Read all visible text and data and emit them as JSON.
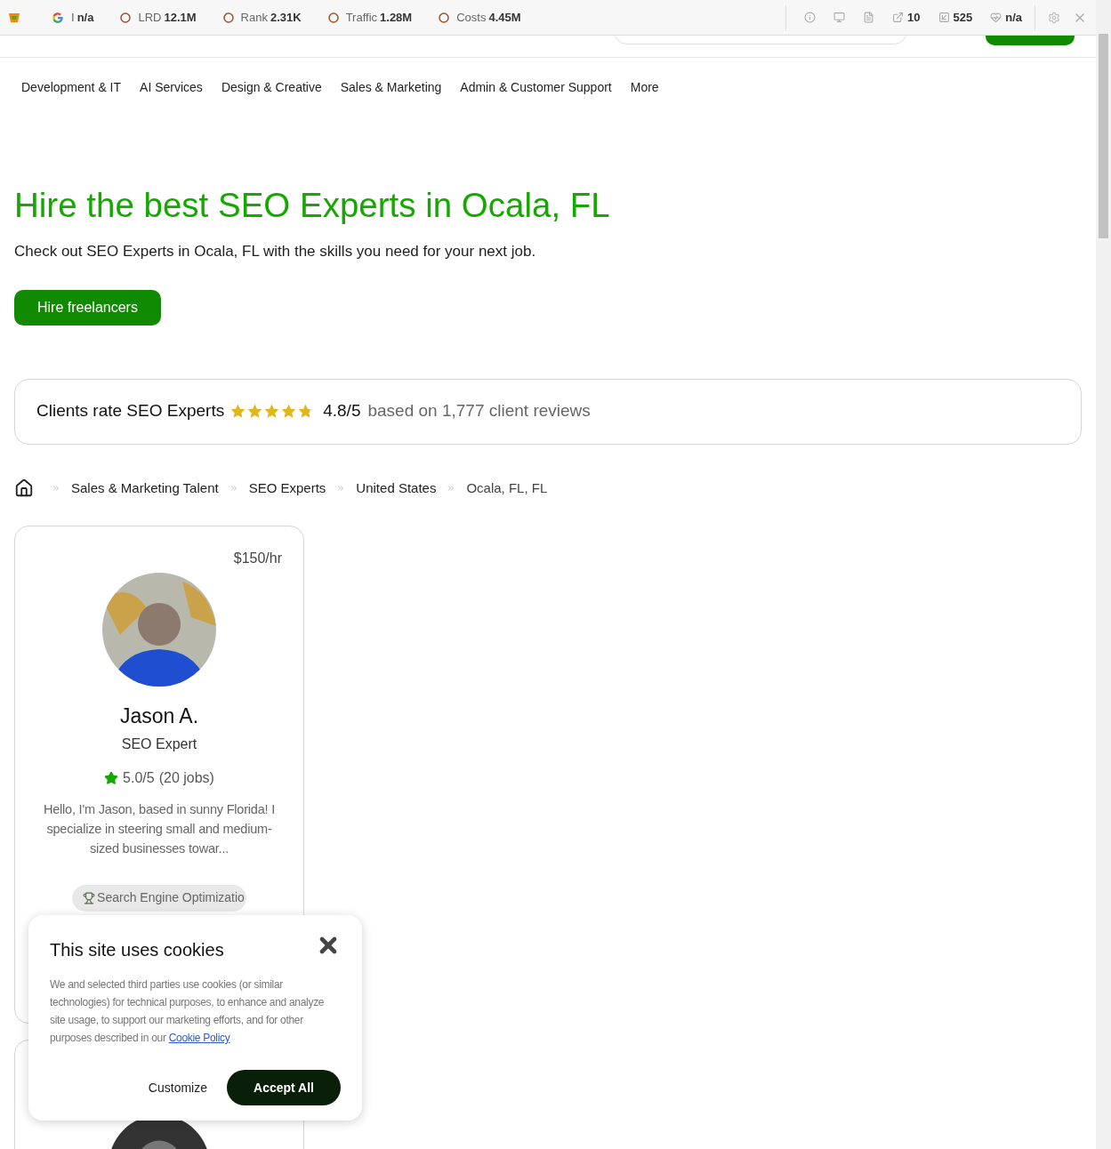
{
  "toolbar": {
    "metrics": [
      {
        "kind": "google",
        "label": "I",
        "value": "n/a"
      },
      {
        "kind": "circle",
        "label": "LRD",
        "value": "12.1M"
      },
      {
        "kind": "circle",
        "label": "Rank",
        "value": "2.31K"
      },
      {
        "kind": "circle",
        "label": "Traffic",
        "value": "1.28M"
      },
      {
        "kind": "circle",
        "label": "Costs",
        "value": "4.45M"
      }
    ],
    "stats": [
      {
        "kind": "info"
      },
      {
        "kind": "monitor"
      },
      {
        "kind": "document"
      },
      {
        "kind": "external",
        "value": "10"
      },
      {
        "kind": "inbound",
        "value": "525"
      },
      {
        "kind": "heart",
        "value": "n/a"
      }
    ]
  },
  "nav": [
    "Development & IT",
    "AI Services",
    "Design & Creative",
    "Sales & Marketing",
    "Admin & Customer Support",
    "More"
  ],
  "hero": {
    "title": "Hire the best SEO Experts in Ocala, FL",
    "subtitle": "Check out SEO Experts in Ocala, FL with the skills you need for your next job.",
    "button": "Hire freelancers"
  },
  "rating": {
    "label": "Clients rate SEO Experts",
    "stars": 4.8,
    "score": "4.8/5",
    "reviews": "based on 1,777 client reviews"
  },
  "breadcrumbs": [
    "Sales & Marketing Talent",
    "SEO Experts",
    "United States",
    "Ocala, FL, FL"
  ],
  "profile": {
    "rate": "$150/hr",
    "name": "Jason A.",
    "title": "SEO Expert",
    "score": "5.0/5",
    "jobs": "(20 jobs)",
    "bio": "Hello, I'm Jason, based in sunny Florida! I specialize in steering small and medium-sized businesses towar...",
    "skill": "Search Engine Optimizatio"
  },
  "cookie": {
    "title": "This site uses cookies",
    "text": "We and selected third parties use cookies (or similar technologies) for technical purposes, to enhance and analyze site usage, to support our marketing efforts, and for other purposes described in our",
    "link": "Cookie Policy",
    "customize": "Customize",
    "accept": "Accept All"
  }
}
